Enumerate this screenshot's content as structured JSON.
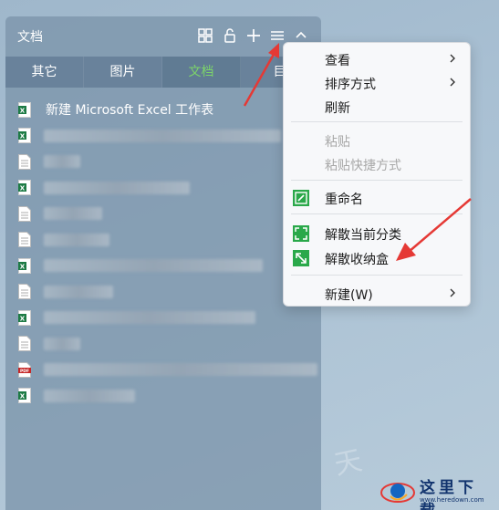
{
  "box": {
    "title": "文档",
    "tabs": [
      {
        "label": "其它",
        "active": false
      },
      {
        "label": "图片",
        "active": false
      },
      {
        "label": "文档",
        "active": true
      },
      {
        "label": "目",
        "active": false
      }
    ],
    "icons": [
      "grid-view-icon",
      "lock-icon",
      "add-icon",
      "menu-icon",
      "collapse-icon"
    ],
    "files": [
      {
        "type": "excel",
        "name": "新建 Microsoft Excel 工作表"
      },
      {
        "type": "excel",
        "name": ""
      },
      {
        "type": "text",
        "name": ""
      },
      {
        "type": "excel",
        "name": ""
      },
      {
        "type": "text",
        "name": ""
      },
      {
        "type": "text",
        "name": ""
      },
      {
        "type": "excel",
        "name": ""
      },
      {
        "type": "text",
        "name": ""
      },
      {
        "type": "excel",
        "name": ""
      },
      {
        "type": "text",
        "name": ""
      },
      {
        "type": "pdf",
        "name": ""
      },
      {
        "type": "excel",
        "name": ""
      }
    ]
  },
  "menu": {
    "items": [
      {
        "label": "查看",
        "submenu": true,
        "disabled": false
      },
      {
        "label": "排序方式",
        "submenu": true,
        "disabled": false
      },
      {
        "label": "刷新",
        "submenu": false,
        "disabled": false
      },
      {
        "label": "粘贴",
        "submenu": false,
        "disabled": true
      },
      {
        "label": "粘贴快捷方式",
        "submenu": false,
        "disabled": true
      },
      {
        "label": "重命名",
        "submenu": false,
        "disabled": false,
        "icon": "rename-icon"
      },
      {
        "label": "解散当前分类",
        "submenu": false,
        "disabled": false,
        "icon": "dissolve-category-icon"
      },
      {
        "label": "解散收纳盒",
        "submenu": false,
        "disabled": false,
        "icon": "dissolve-box-icon"
      },
      {
        "label": "新建(W)",
        "submenu": true,
        "disabled": false
      }
    ]
  },
  "watermark": {
    "text": "天",
    "logo_title": "这里下载",
    "logo_url": "www.heredown.com"
  },
  "colors": {
    "active_tab": "#7cd46a",
    "menu_icon_green": "#2aa84a",
    "annotation_arrow": "#e53935"
  }
}
